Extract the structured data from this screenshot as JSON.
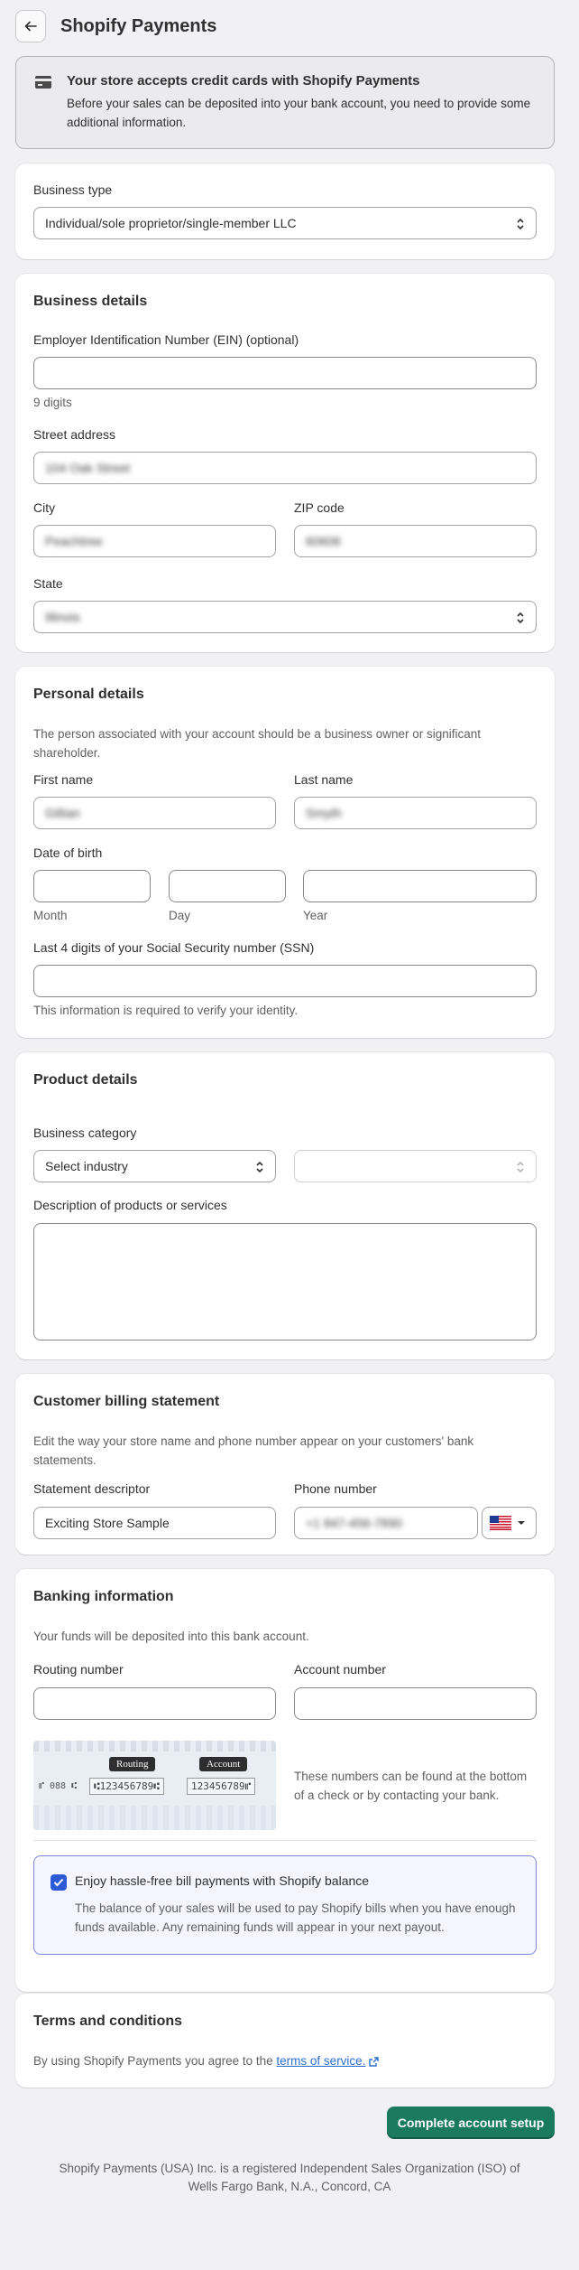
{
  "header": {
    "title": "Shopify Payments"
  },
  "banner": {
    "title": "Your store accepts credit cards with Shopify Payments",
    "text": "Before your sales can be deposited into your bank account, you need to provide some additional information."
  },
  "business_type": {
    "label": "Business type",
    "value": "Individual/sole proprietor/single-member LLC"
  },
  "business_details": {
    "title": "Business details",
    "ein_label": "Employer Identification Number (EIN) (optional)",
    "ein_help": "9 digits",
    "street_label": "Street address",
    "street_value": "104 Oak Street",
    "city_label": "City",
    "city_value": "Peachtree",
    "zip_label": "ZIP code",
    "zip_value": "60606",
    "state_label": "State",
    "state_value": "Illinois"
  },
  "personal_details": {
    "title": "Personal details",
    "description": "The person associated with your account should be a business owner or significant shareholder.",
    "first_label": "First name",
    "first_value": "Gillian",
    "last_label": "Last name",
    "last_value": "Smyth",
    "dob_label": "Date of birth",
    "month_help": "Month",
    "day_help": "Day",
    "year_help": "Year",
    "ssn_label": "Last 4 digits of your Social Security number (SSN)",
    "ssn_help": "This information is required to verify your identity."
  },
  "product_details": {
    "title": "Product details",
    "category_label": "Business category",
    "industry_value": "Select industry",
    "description_label": "Description of products or services"
  },
  "billing_statement": {
    "title": "Customer billing statement",
    "description": "Edit the way your store name and phone number appear on your customers' bank statements.",
    "descriptor_label": "Statement descriptor",
    "descriptor_value": "Exciting Store Sample",
    "phone_label": "Phone number",
    "phone_value": "+1 847-456-7890"
  },
  "banking": {
    "title": "Banking information",
    "description": "Your funds will be deposited into this bank account.",
    "routing_label": "Routing number",
    "account_label": "Account number",
    "check_routing_tag": "Routing",
    "check_account_tag": "Account",
    "check_prefix": "⑈ 088 ⑆",
    "check_routing_digits": "⑆123456789⑆",
    "check_account_digits": "123456789⑈",
    "check_help": "These numbers can be found at the bottom of a check or by contacting your bank.",
    "balance_label": "Enjoy hassle-free bill payments with Shopify balance",
    "balance_description": "The balance of your sales will be used to pay Shopify bills when you have enough funds available. Any remaining funds will appear in your next payout."
  },
  "terms": {
    "title": "Terms and conditions",
    "text": "By using Shopify Payments you agree to the",
    "link": "terms of service."
  },
  "actions": {
    "complete_label": "Complete account setup"
  },
  "footer": {
    "text": "Shopify Payments (USA) Inc. is a registered Independent Sales Organization (ISO) of Wells Fargo Bank, N.A., Concord, CA"
  },
  "colors": {
    "primary": "#1a7a5e",
    "checkbox": "#2d5bd7",
    "link": "#2c6ecb"
  },
  "icons": [
    "back-arrow-icon",
    "credit-card-icon",
    "select-arrows-icon",
    "us-flag-icon",
    "checkmark-icon",
    "external-link-icon"
  ]
}
